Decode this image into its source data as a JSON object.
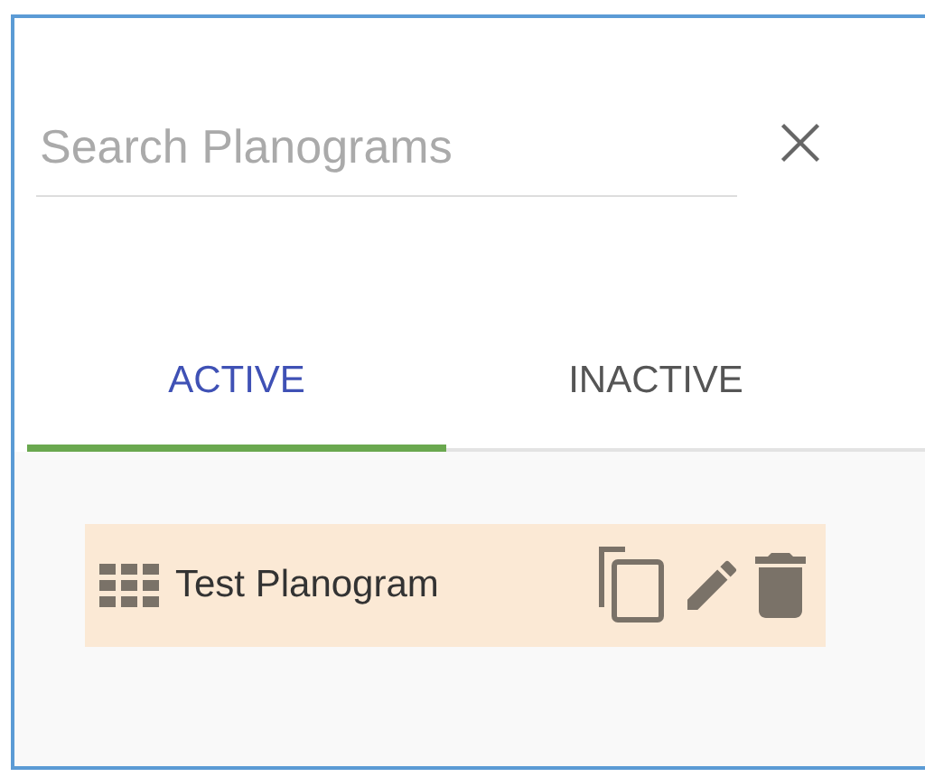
{
  "search": {
    "placeholder": "Search Planograms"
  },
  "tabs": [
    {
      "label": "ACTIVE",
      "selected": true
    },
    {
      "label": "INACTIVE",
      "selected": false
    }
  ],
  "planograms": [
    {
      "name": "Test Planogram",
      "selected": true
    }
  ]
}
